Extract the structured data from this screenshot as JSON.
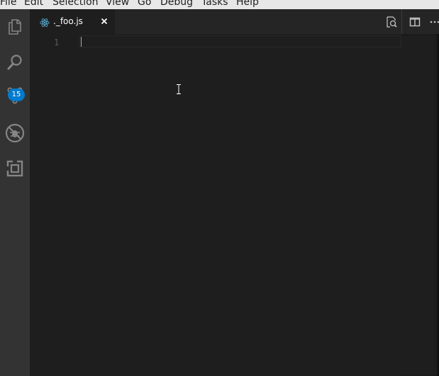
{
  "menubar": {
    "items": [
      "File",
      "Edit",
      "Selection",
      "View",
      "Go",
      "Debug",
      "Tasks",
      "Help"
    ]
  },
  "activitybar": {
    "icons": [
      "files-icon",
      "search-icon",
      "source-control-icon",
      "debug-icon",
      "extensions-icon"
    ],
    "scm_badge": "15"
  },
  "tabs": [
    {
      "label": "._foo.js",
      "icon": "react-file-icon",
      "close": "close-icon"
    }
  ],
  "editor_actions": [
    "open-changes-icon",
    "split-editor-icon",
    "more-actions-icon"
  ],
  "editor": {
    "line_numbers": [
      "1"
    ],
    "lines": [
      ""
    ]
  },
  "colors": {
    "accent": "#007acc",
    "editor_bg": "#1e1e1e",
    "activitybar_bg": "#333333",
    "tabbar_bg": "#252526",
    "menubar_bg": "#e7e7e7",
    "react_icon": "#519aba"
  }
}
